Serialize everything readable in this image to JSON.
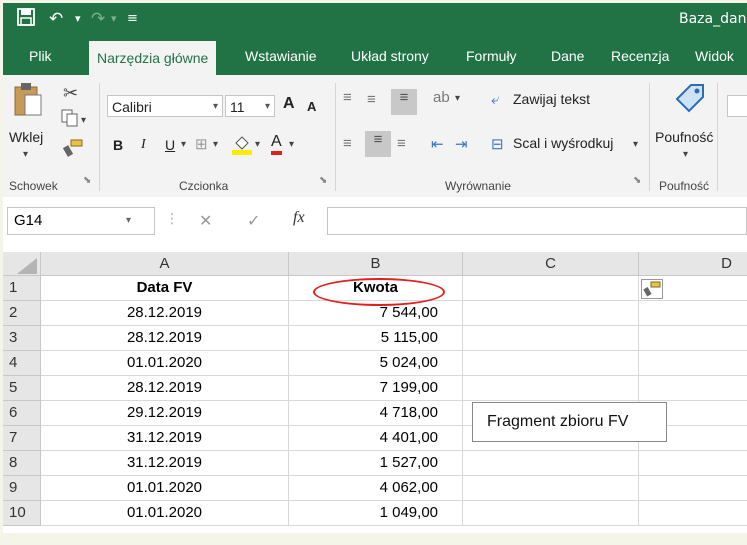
{
  "titlebar": {
    "doc_name": "Baza_dan",
    "save_icon": "save-icon",
    "undo_icon": "undo-icon",
    "redo_icon": "redo-icon",
    "customize_icon": "customize-icon"
  },
  "tabs": [
    {
      "label": "Plik"
    },
    {
      "label": "Narzędzia główne"
    },
    {
      "label": "Wstawianie"
    },
    {
      "label": "Układ strony"
    },
    {
      "label": "Formuły"
    },
    {
      "label": "Dane"
    },
    {
      "label": "Recenzja"
    },
    {
      "label": "Widok"
    }
  ],
  "ribbon": {
    "clipboard": {
      "paste_label": "Wklej",
      "group_label": "Schowek"
    },
    "font": {
      "font_name": "Calibri",
      "font_size": "11",
      "bold": "B",
      "italic": "I",
      "underline": "U",
      "grow": "A",
      "shrink": "A",
      "font_color": "A",
      "group_label": "Czcionka"
    },
    "alignment": {
      "wrap_label": "Zawijaj tekst",
      "merge_label": "Scal i wyśrodkuj",
      "group_label": "Wyrównanie"
    },
    "sensitivity": {
      "label": "Poufność",
      "group_label": "Poufność"
    }
  },
  "formula_bar": {
    "name_box": "G14",
    "fx": "fx",
    "cancel": "✕",
    "enter": "✓",
    "value": ""
  },
  "sheet": {
    "columns": [
      "A",
      "B",
      "C",
      "D"
    ],
    "header_row": {
      "row": "1",
      "a": "Data FV",
      "b": "Kwota"
    },
    "rows": [
      {
        "row": "2",
        "a": "28.12.2019",
        "b": "7 544,00"
      },
      {
        "row": "3",
        "a": "28.12.2019",
        "b": "5 115,00"
      },
      {
        "row": "4",
        "a": "01.01.2020",
        "b": "5 024,00"
      },
      {
        "row": "5",
        "a": "28.12.2019",
        "b": "7 199,00"
      },
      {
        "row": "6",
        "a": "29.12.2019",
        "b": "4 718,00"
      },
      {
        "row": "7",
        "a": "31.12.2019",
        "b": "4 401,00"
      },
      {
        "row": "8",
        "a": "31.12.2019",
        "b": "1 527,00"
      },
      {
        "row": "9",
        "a": "01.01.2020",
        "b": "4 062,00"
      },
      {
        "row": "10",
        "a": "01.01.2020",
        "b": "1 049,00"
      }
    ]
  },
  "callout": {
    "text": "Fragment zbioru FV"
  },
  "colors": {
    "excel_green": "#217346",
    "highlight_ellipse": "#e0201c"
  }
}
